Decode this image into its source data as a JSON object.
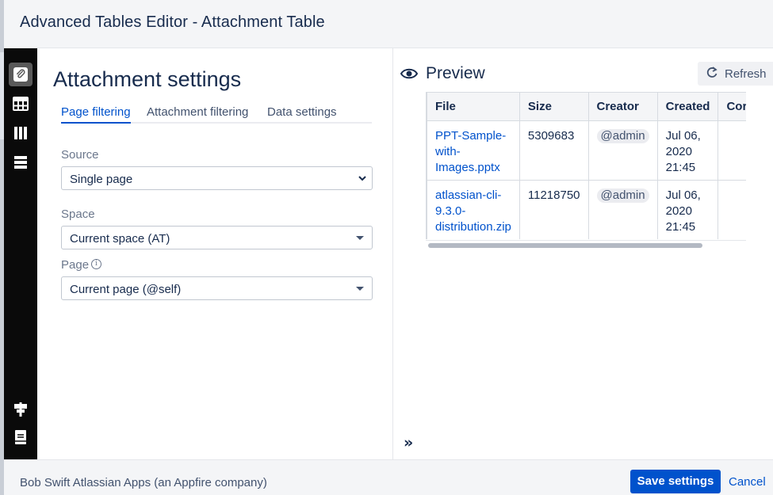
{
  "app": {
    "title": "Advanced Tables Editor - Attachment Table"
  },
  "rail": {
    "icons": [
      "paperclip-icon",
      "table-icon",
      "columns-icon",
      "rows-icon",
      "signpost-icon",
      "book-icon"
    ],
    "active": "paperclip-icon"
  },
  "settings": {
    "heading": "Attachment settings",
    "tabs": [
      {
        "label": "Page filtering",
        "active": true
      },
      {
        "label": "Attachment filtering",
        "active": false
      },
      {
        "label": "Data settings",
        "active": false
      }
    ],
    "source": {
      "label": "Source",
      "value": "Single page"
    },
    "space": {
      "label": "Space",
      "value": "Current space (AT)"
    },
    "page": {
      "label": "Page",
      "value": "Current page (@self)",
      "info_icon": "info-icon"
    }
  },
  "preview": {
    "title": "Preview",
    "refresh_label": "Refresh",
    "columns": [
      "File",
      "Size",
      "Creator",
      "Created",
      "Cor"
    ],
    "rows": [
      {
        "file_lines": [
          "PPT-Sample-",
          "with-",
          "Images.pptx"
        ],
        "size": "5309683",
        "creator": "@admin",
        "created_lines": [
          "Jul 06,",
          "2020",
          "21:45"
        ]
      },
      {
        "file_lines": [
          "atlassian-cli-",
          "9.3.0-",
          "distribution.zip"
        ],
        "size": "11218750",
        "creator": "@admin",
        "created_lines": [
          "Jul 06,",
          "2020",
          "21:45"
        ]
      }
    ]
  },
  "footer": {
    "credit": "Bob Swift Atlassian Apps (an Appfire company)",
    "save_label": "Save settings",
    "cancel_label": "Cancel"
  },
  "colors": {
    "primary": "#0052cc",
    "rail": "#0a0a0a",
    "text": "#172b4d",
    "header_bg": "#f4f5f7"
  }
}
